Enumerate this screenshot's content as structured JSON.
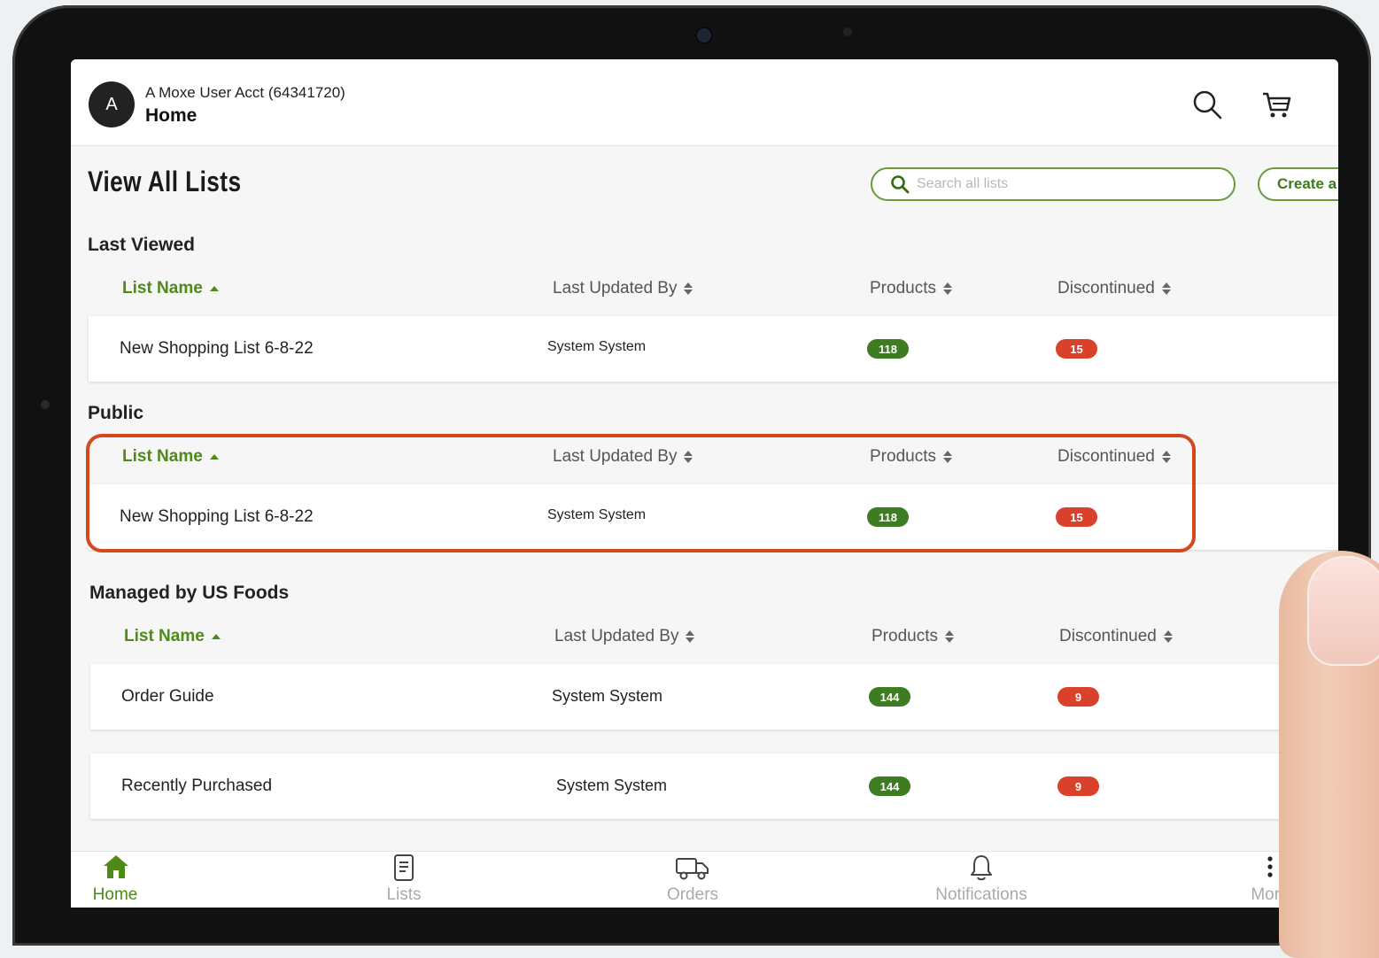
{
  "header": {
    "avatar_letter": "A",
    "account": "A Moxe User Acct (64341720)",
    "title": "Home"
  },
  "page": {
    "title": "View All Lists",
    "search_placeholder": "Search all lists",
    "create_label": "Create a L"
  },
  "columns": {
    "name": "List Name",
    "updated_by": "Last Updated By",
    "products": "Products",
    "discontinued": "Discontinued"
  },
  "sections": [
    {
      "title": "Last Viewed",
      "rows": [
        {
          "name": "New Shopping List 6-8-22",
          "updated_by": "System System",
          "products": "118",
          "discontinued": "15"
        }
      ]
    },
    {
      "title": "Public",
      "rows": [
        {
          "name": "New Shopping List 6-8-22",
          "updated_by": "System System",
          "products": "118",
          "discontinued": "15"
        }
      ]
    },
    {
      "title": "Managed by US Foods",
      "rows": [
        {
          "name": "Order Guide",
          "updated_by": "System System",
          "products": "144",
          "discontinued": "9"
        },
        {
          "name": "Recently Purchased",
          "updated_by": "System System",
          "products": "144",
          "discontinued": "9"
        }
      ]
    }
  ],
  "nav": {
    "home": "Home",
    "lists": "Lists",
    "orders": "Orders",
    "notifications": "Notifications",
    "more": "More"
  },
  "colors": {
    "accent_green": "#4e8a17",
    "products_pill": "#3e7c22",
    "discontinued_pill": "#d9412a",
    "highlight_border": "#d4481f"
  }
}
